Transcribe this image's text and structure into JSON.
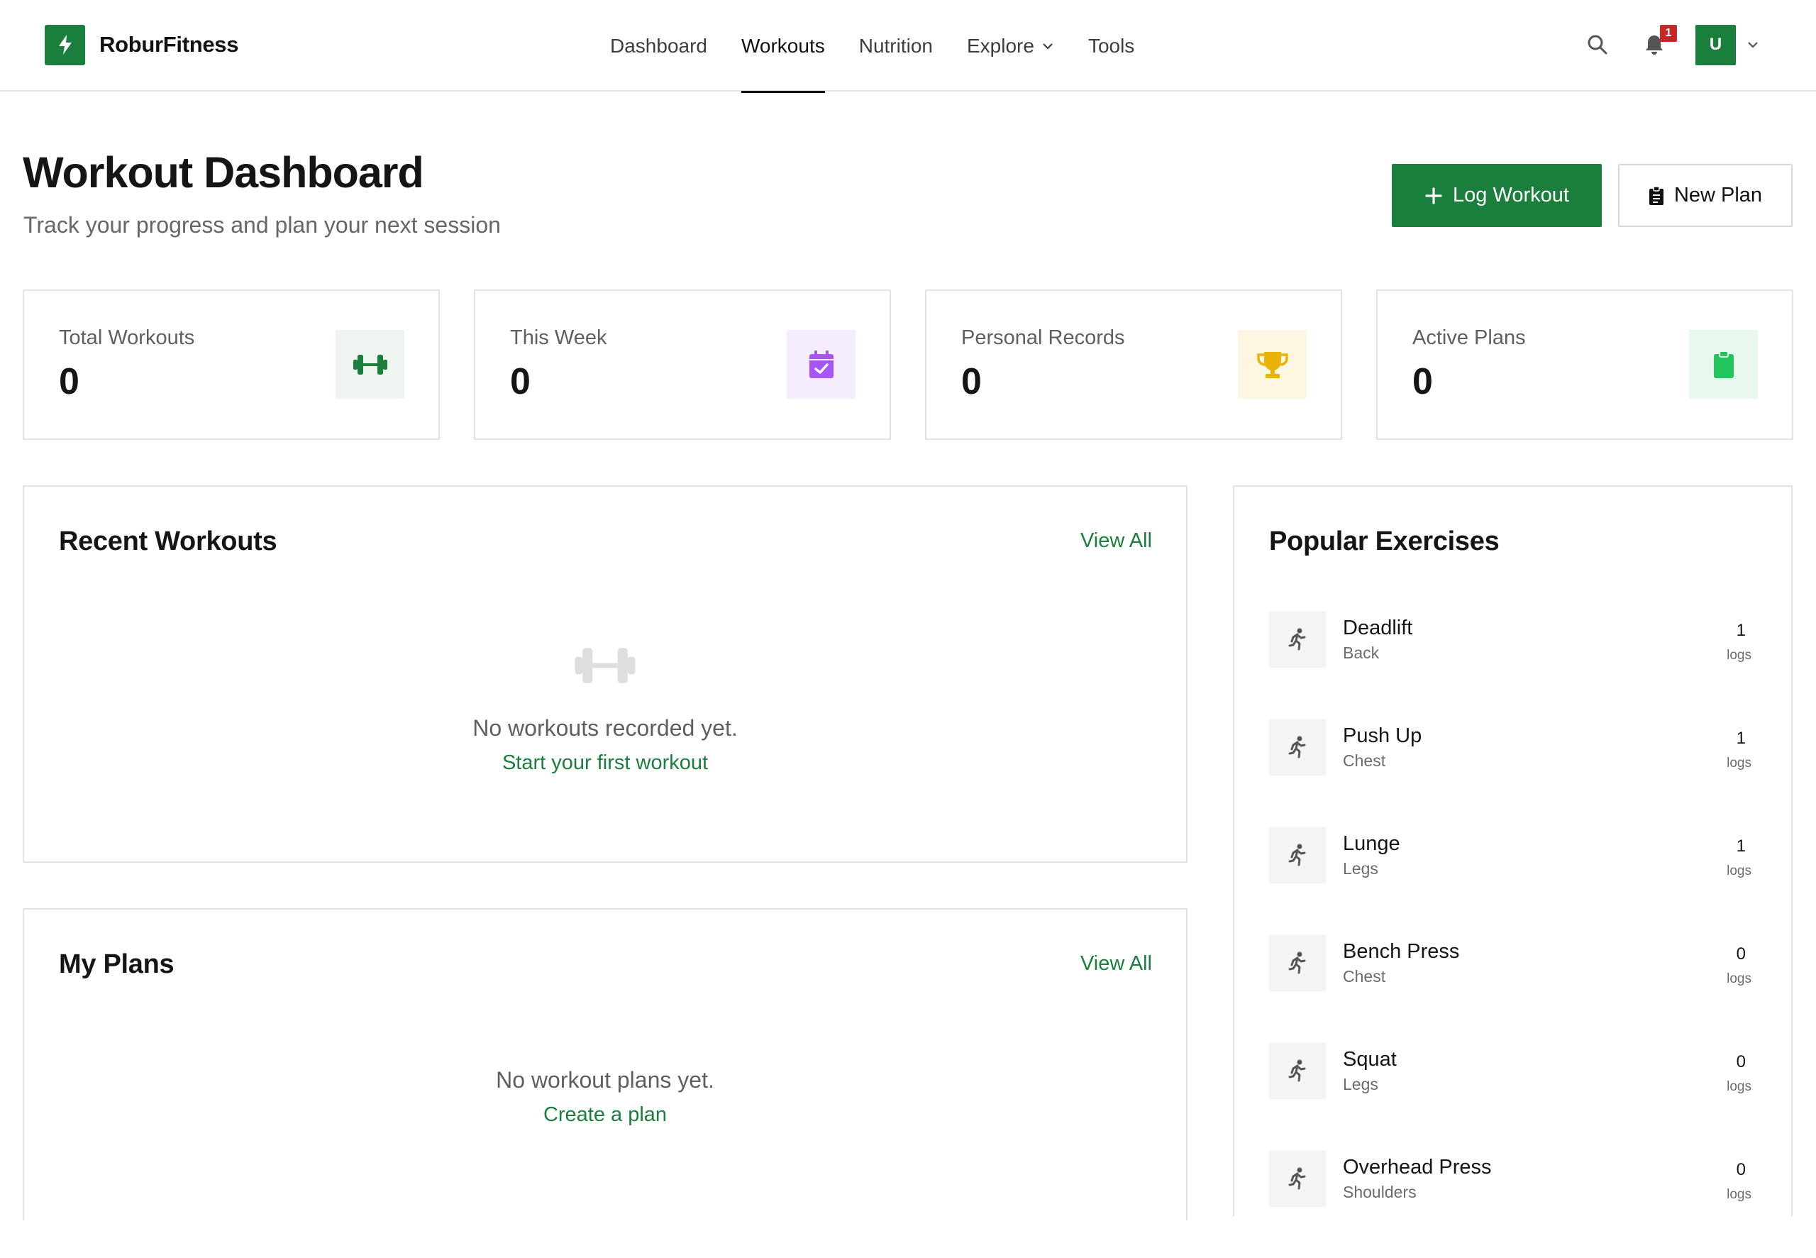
{
  "app": {
    "brand": "RoburFitness",
    "accent": "#1a7f3c"
  },
  "nav": {
    "items": [
      {
        "label": "Dashboard",
        "active": false
      },
      {
        "label": "Workouts",
        "active": true
      },
      {
        "label": "Nutrition",
        "active": false
      },
      {
        "label": "Explore",
        "active": false,
        "dropdown": true
      },
      {
        "label": "Tools",
        "active": false
      }
    ]
  },
  "header": {
    "notifications_count": "1",
    "avatar_initial": "U",
    "icons": [
      "search-icon",
      "bell-icon",
      "chevron-down-icon"
    ]
  },
  "page": {
    "title": "Workout Dashboard",
    "subtitle": "Track your progress and plan your next session",
    "log_workout_label": "Log Workout",
    "new_plan_label": "New Plan"
  },
  "stats": [
    {
      "label": "Total Workouts",
      "value": "0",
      "icon": "dumbbell-icon",
      "color": "#1a7f3c",
      "bg": "#eef4ef"
    },
    {
      "label": "This Week",
      "value": "0",
      "icon": "calendar-check-icon",
      "color": "#a855f7",
      "bg": "#f5ecfd"
    },
    {
      "label": "Personal Records",
      "value": "0",
      "icon": "trophy-icon",
      "color": "#eab308",
      "bg": "#fdf6e3"
    },
    {
      "label": "Active Plans",
      "value": "0",
      "icon": "clipboard-icon",
      "color": "#22c55e",
      "bg": "#e8f8ee"
    }
  ],
  "recent_workouts": {
    "title": "Recent Workouts",
    "view_all": "View All",
    "empty_text": "No workouts recorded yet.",
    "empty_link": "Start your first workout"
  },
  "my_plans": {
    "title": "My Plans",
    "view_all": "View All",
    "empty_text": "No workout plans yet.",
    "empty_link": "Create a plan"
  },
  "popular": {
    "title": "Popular Exercises",
    "exercises": [
      {
        "name": "Deadlift",
        "category": "Back",
        "count": "1",
        "unit": "logs"
      },
      {
        "name": "Push Up",
        "category": "Chest",
        "count": "1",
        "unit": "logs"
      },
      {
        "name": "Lunge",
        "category": "Legs",
        "count": "1",
        "unit": "logs"
      },
      {
        "name": "Bench Press",
        "category": "Chest",
        "count": "0",
        "unit": "logs"
      },
      {
        "name": "Squat",
        "category": "Legs",
        "count": "0",
        "unit": "logs"
      },
      {
        "name": "Overhead Press",
        "category": "Shoulders",
        "count": "0",
        "unit": "logs"
      }
    ]
  }
}
